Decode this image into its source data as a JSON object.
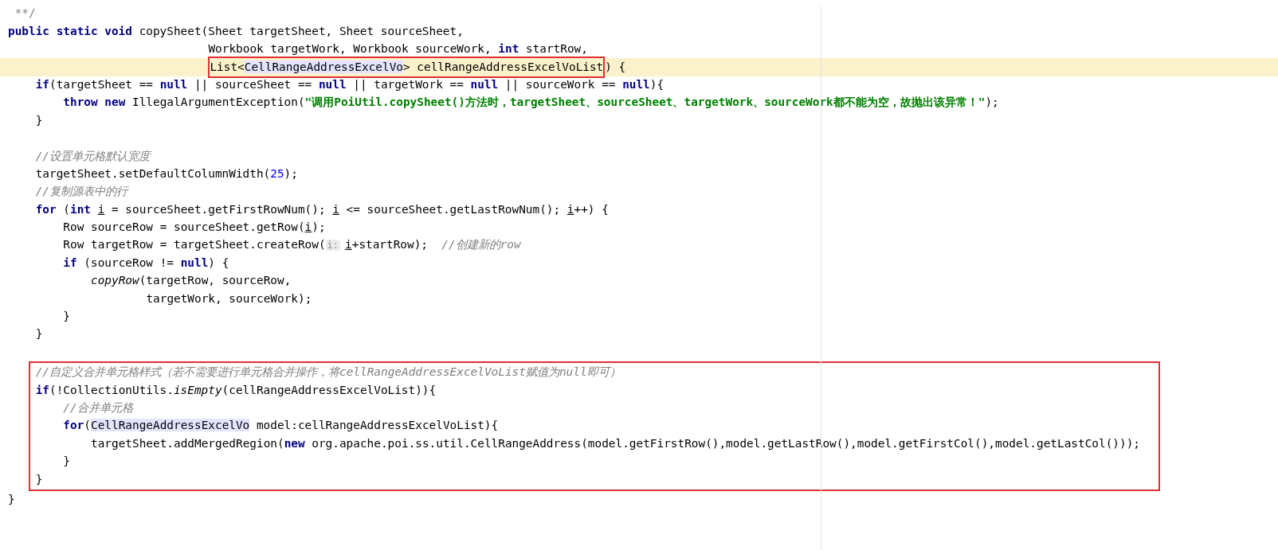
{
  "lines": [
    {
      "kind": "doc",
      "current": false,
      "tokens": [
        {
          "kind": "doc",
          "text": "**/"
        }
      ]
    },
    {
      "kind": "statement",
      "current": false,
      "tokens": [
        {
          "kind": "keyword",
          "text": "public static void "
        },
        {
          "kind": "plain",
          "text": "copySheet(Sheet targetSheet, Sheet sourceSheet,"
        }
      ]
    },
    {
      "kind": "aligned",
      "current": false,
      "tokens": [
        {
          "kind": "plain",
          "text": "Workbook targetWork, Workbook sourceWork, "
        },
        {
          "kind": "keyword",
          "text": "int "
        },
        {
          "kind": "plain",
          "text": "startRow,"
        }
      ]
    },
    {
      "kind": "aligned",
      "current": true,
      "tokens": [
        {
          "kind": "box",
          "tokens": [
            {
              "kind": "plain",
              "text": "List<"
            },
            {
              "kind": "highlight",
              "text": "CellRangeAddressExcelVo"
            },
            {
              "kind": "plain",
              "text": "> cellRangeAddressExcelVoList"
            }
          ]
        },
        {
          "kind": "plain",
          "text": ") {"
        }
      ],
      "children": [
        {
          "kind": "statement",
          "current": false,
          "tokens": [
            {
              "kind": "keyword",
              "text": "if"
            },
            {
              "kind": "plain",
              "text": "(targetSheet == "
            },
            {
              "kind": "keyword",
              "text": "null"
            },
            {
              "kind": "plain",
              "text": " || sourceSheet == "
            },
            {
              "kind": "keyword",
              "text": "null"
            },
            {
              "kind": "plain",
              "text": " || targetWork == "
            },
            {
              "kind": "keyword",
              "text": "null"
            },
            {
              "kind": "plain",
              "text": " || sourceWork == "
            },
            {
              "kind": "keyword",
              "text": "null"
            },
            {
              "kind": "plain",
              "text": "){"
            }
          ],
          "children": [
            {
              "kind": "statement",
              "current": false,
              "tokens": [
                {
                  "kind": "keyword",
                  "text": "throw new "
                },
                {
                  "kind": "plain",
                  "text": "IllegalArgumentException("
                },
                {
                  "kind": "string",
                  "text": "\"调用PoiUtil.copySheet()方法时，targetSheet、sourceSheet、targetWork、sourceWork都不能为空，故抛出该异常！\""
                },
                {
                  "kind": "plain",
                  "text": ");"
                }
              ]
            }
          ]
        },
        {
          "kind": "statement",
          "current": false,
          "tokens": [
            {
              "kind": "plain",
              "text": "}"
            }
          ]
        },
        {
          "kind": "statement",
          "current": false
        },
        {
          "kind": "statement",
          "current": false,
          "tokens": [
            {
              "kind": "comment",
              "text": "//设置单元格默认宽度"
            }
          ]
        },
        {
          "kind": "statement",
          "current": false,
          "tokens": [
            {
              "kind": "plain",
              "text": "targetSheet.setDefaultColumnWidth("
            },
            {
              "kind": "number",
              "text": "25"
            },
            {
              "kind": "plain",
              "text": ");"
            }
          ]
        },
        {
          "kind": "statement",
          "current": false,
          "tokens": [
            {
              "kind": "comment",
              "text": "//复制源表中的行"
            }
          ]
        },
        {
          "kind": "statement",
          "current": false,
          "tokens": [
            {
              "kind": "keyword",
              "text": "for"
            },
            {
              "kind": "plain",
              "text": " ("
            },
            {
              "kind": "keyword",
              "text": "int "
            },
            {
              "kind": "underlined",
              "text": "i"
            },
            {
              "kind": "plain",
              "text": " = sourceSheet.getFirstRowNum(); "
            },
            {
              "kind": "underlined",
              "text": "i"
            },
            {
              "kind": "plain",
              "text": " <= sourceSheet.getLastRowNum(); "
            },
            {
              "kind": "underlined",
              "text": "i"
            },
            {
              "kind": "plain",
              "text": "++) {"
            }
          ],
          "children": [
            {
              "kind": "statement",
              "current": false,
              "tokens": [
                {
                  "kind": "plain",
                  "text": "Row sourceRow = sourceSheet.getRow("
                },
                {
                  "kind": "underlined",
                  "text": "i"
                },
                {
                  "kind": "plain",
                  "text": ");"
                }
              ]
            },
            {
              "kind": "statement",
              "current": false,
              "tokens": [
                {
                  "kind": "plain",
                  "text": "Row targetRow = targetSheet.createRow("
                },
                {
                  "kind": "hint",
                  "text": "i:"
                },
                {
                  "kind": "underlined",
                  "text": "i"
                },
                {
                  "kind": "plain",
                  "text": "+startRow);  "
                },
                {
                  "kind": "comment",
                  "text": "//创建新的row"
                }
              ]
            },
            {
              "kind": "statement",
              "current": false,
              "tokens": [
                {
                  "kind": "keyword",
                  "text": "if"
                },
                {
                  "kind": "plain",
                  "text": " (sourceRow != "
                },
                {
                  "kind": "keyword",
                  "text": "null"
                },
                {
                  "kind": "plain",
                  "text": ") {"
                }
              ],
              "children": [
                {
                  "kind": "statement",
                  "current": false,
                  "tokens": [
                    {
                      "kind": "static",
                      "text": "copyRow"
                    },
                    {
                      "kind": "plain",
                      "text": "(targetRow, sourceRow,"
                    }
                  ]
                },
                {
                  "kind": "continuation",
                  "current": false,
                  "tokens": [
                    {
                      "kind": "plain",
                      "text": "targetWork, sourceWork);"
                    }
                  ]
                }
              ]
            },
            {
              "kind": "statement",
              "current": false,
              "tokens": [
                {
                  "kind": "plain",
                  "text": "}"
                }
              ]
            }
          ]
        },
        {
          "kind": "statement",
          "current": false,
          "tokens": [
            {
              "kind": "plain",
              "text": "}"
            }
          ]
        },
        {
          "kind": "statement",
          "current": false
        },
        {
          "kind": "boxed",
          "children": [
            {
              "kind": "statement",
              "current": false,
              "tokens": [
                {
                  "kind": "comment",
                  "text": "//自定义合并单元格样式（若不需要进行单元格合并操作，将cellRangeAddressExcelVoList赋值为null即可）"
                }
              ]
            },
            {
              "kind": "statement",
              "current": false,
              "tokens": [
                {
                  "kind": "keyword",
                  "text": "if"
                },
                {
                  "kind": "plain",
                  "text": "(!CollectionUtils."
                },
                {
                  "kind": "static",
                  "text": "isEmpty"
                },
                {
                  "kind": "plain",
                  "text": "(cellRangeAddressExcelVoList)){"
                }
              ],
              "children": [
                {
                  "kind": "statement",
                  "current": false,
                  "tokens": [
                    {
                      "kind": "comment",
                      "text": "//合并单元格"
                    }
                  ]
                },
                {
                  "kind": "statement",
                  "current": false,
                  "tokens": [
                    {
                      "kind": "keyword",
                      "text": "for"
                    },
                    {
                      "kind": "plain",
                      "text": "("
                    },
                    {
                      "kind": "highlight",
                      "text": "CellRangeAddressExcelVo"
                    },
                    {
                      "kind": "plain",
                      "text": " model:cellRangeAddressExcelVoList){"
                    }
                  ],
                  "children": [
                    {
                      "kind": "statement",
                      "current": false,
                      "tokens": [
                        {
                          "kind": "plain",
                          "text": "targetSheet.addMergedRegion("
                        },
                        {
                          "kind": "keyword",
                          "text": "new"
                        },
                        {
                          "kind": "plain",
                          "text": " org.apache.poi.ss.util.CellRangeAddress(model.getFirstRow(),model.getLastRow(),model.getFirstCol(),model.getLastCol()));"
                        }
                      ]
                    }
                  ]
                },
                {
                  "kind": "statement",
                  "current": false,
                  "tokens": [
                    {
                      "kind": "plain",
                      "text": "}"
                    }
                  ]
                }
              ]
            },
            {
              "kind": "statement",
              "current": false,
              "tokens": [
                {
                  "kind": "plain",
                  "text": "}"
                }
              ]
            }
          ]
        }
      ]
    },
    {
      "kind": "statement",
      "current": false,
      "tokens": [
        {
          "kind": "plain",
          "text": "}"
        }
      ]
    }
  ]
}
